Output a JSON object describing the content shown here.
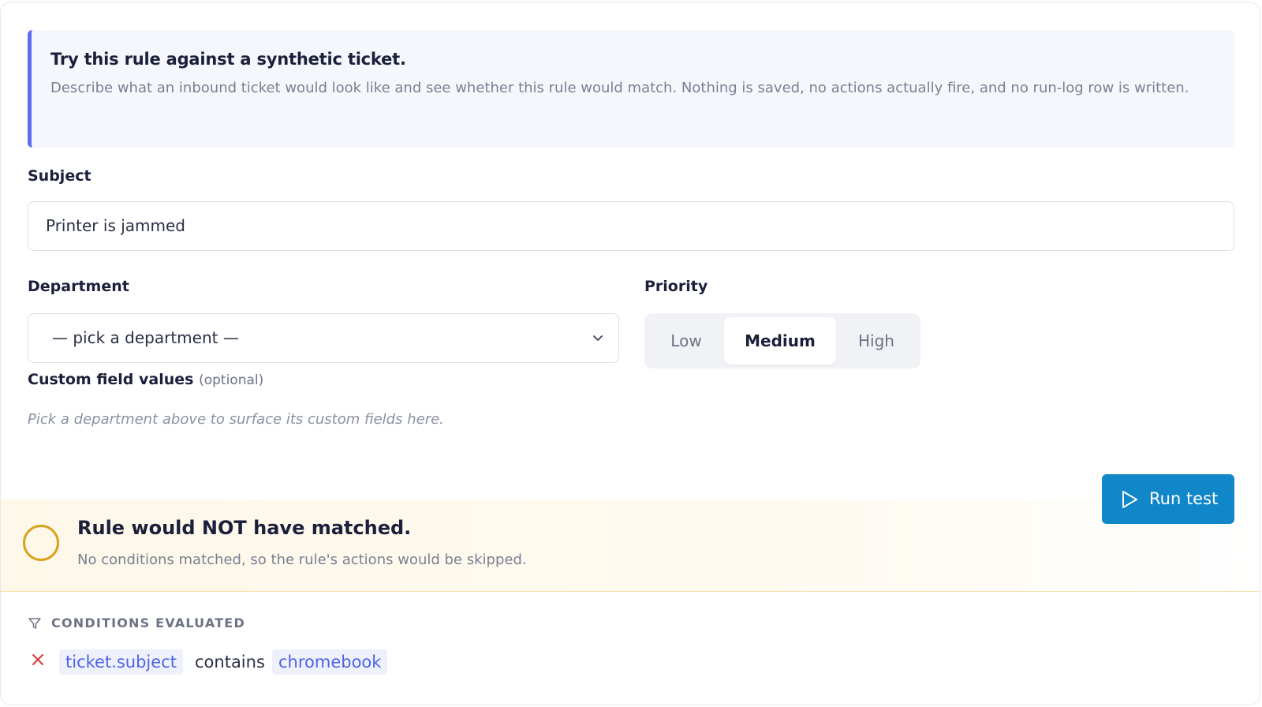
{
  "callout": {
    "title": "Try this rule against a synthetic ticket.",
    "text": "Describe what an inbound ticket would look like and see whether this rule would match. Nothing is saved, no actions actually fire, and no run-log row is written."
  },
  "form": {
    "subject_label": "Subject",
    "subject_value": "Printer is jammed",
    "department_label": "Department",
    "department_selected": "— pick a department —",
    "priority_label": "Priority",
    "priority_options": [
      "Low",
      "Medium",
      "High"
    ],
    "priority_selected": "Medium",
    "custom_fields_label": "Custom field values",
    "custom_fields_optional": "(optional)",
    "custom_fields_hint": "Pick a department above to surface its custom fields here."
  },
  "run_button": {
    "label": "Run test",
    "color": "#1187c9"
  },
  "result": {
    "title": "Rule would NOT have matched.",
    "text": "No conditions matched, so the rule's actions would be skipped.",
    "status_color": "#d9a21b"
  },
  "conditions": {
    "heading": "CONDITIONS EVALUATED",
    "items": [
      {
        "field": "ticket.subject",
        "operator": "contains",
        "value": "chromebook",
        "passed": false
      }
    ]
  },
  "icons": [
    "chevron-down-icon",
    "play-icon",
    "funnel-icon",
    "x-icon",
    "status-circle-icon"
  ],
  "colors": {
    "accent": "#5b6cf0",
    "link": "#4e63e6",
    "fail": "#d83a3a"
  }
}
